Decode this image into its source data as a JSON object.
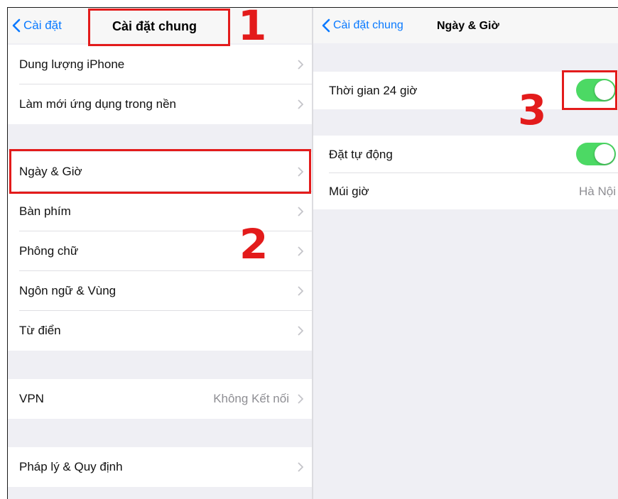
{
  "left_panel": {
    "back_label": "Cài đặt",
    "title": "Cài đặt chung",
    "rows": [
      {
        "label": "Dung lượng iPhone",
        "value": ""
      },
      {
        "label": "Làm mới ứng dụng trong nền",
        "value": ""
      },
      {
        "label": "Ngày & Giờ",
        "value": ""
      },
      {
        "label": "Bàn phím",
        "value": ""
      },
      {
        "label": "Phông chữ",
        "value": ""
      },
      {
        "label": "Ngôn ngữ & Vùng",
        "value": ""
      },
      {
        "label": "Từ điển",
        "value": ""
      },
      {
        "label": "VPN",
        "value": "Không Kết nối"
      },
      {
        "label": "Pháp lý & Quy định",
        "value": ""
      }
    ]
  },
  "right_panel": {
    "back_label": "Cài đặt chung",
    "title": "Ngày & Giờ",
    "rows": [
      {
        "label": "Thời gian 24 giờ",
        "toggle_on": true
      },
      {
        "label": "Đặt tự động",
        "toggle_on": true
      },
      {
        "label": "Múi giờ",
        "value": "Hà Nội"
      }
    ]
  },
  "annotations": {
    "step1": "1",
    "step2": "2",
    "step3": "3",
    "color": "#e31b1b"
  },
  "colors": {
    "accent": "#0a7aff",
    "toggle_on": "#4cd964",
    "background": "#efeff4"
  }
}
